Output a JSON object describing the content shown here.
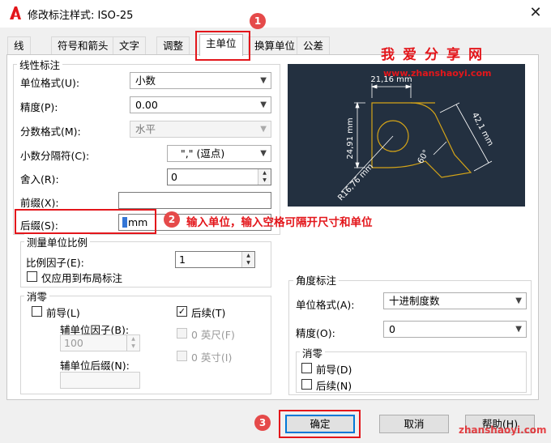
{
  "window": {
    "title": "修改标注样式: ISO-25",
    "close_glyph": "✕"
  },
  "tabs": [
    "线",
    "符号和箭头",
    "文字",
    "调整",
    "主单位",
    "换算单位",
    "公差"
  ],
  "linear": {
    "group_title": "线性标注",
    "unit_format_label": "单位格式(U):",
    "unit_format_value": "小数",
    "precision_label": "精度(P):",
    "precision_value": "0.00",
    "fraction_format_label": "分数格式(M):",
    "fraction_format_value": "水平",
    "decimal_sep_label": "小数分隔符(C):",
    "decimal_sep_value": "\",\" (逗点)",
    "round_label": "舍入(R):",
    "round_value": "0",
    "prefix_label": "前缀(X):",
    "prefix_value": "",
    "suffix_label": "后缀(S):",
    "suffix_value": "mm"
  },
  "scale": {
    "group_title": "测量单位比例",
    "factor_label": "比例因子(E):",
    "factor_value": "1",
    "layout_only_label": "仅应用到布局标注"
  },
  "zero_suppression": {
    "group_title": "消零",
    "leading_label": "前导(L)",
    "trailing_label": "后续(T)",
    "sub_unit_factor_label": "辅单位因子(B):",
    "sub_unit_factor_value": "100",
    "sub_unit_suffix_label": "辅单位后缀(N):",
    "sub_unit_suffix_value": "",
    "feet_label": "0 英尺(F)",
    "inches_label": "0 英寸(I)"
  },
  "angular": {
    "group_title": "角度标注",
    "unit_format_label": "单位格式(A):",
    "unit_format_value": "十进制度数",
    "precision_label": "精度(O):",
    "precision_value": "0",
    "zero_group_title": "消零",
    "leading_label": "前导(D)",
    "trailing_label": "后续(N)"
  },
  "preview": {
    "dim_top": "21,16 mm",
    "dim_left": "24,91 mm",
    "dim_right": "42,1 mm",
    "dim_angle": "60°",
    "dim_radius": "R16,76 mm"
  },
  "buttons": {
    "ok": "确定",
    "cancel": "取消",
    "help": "帮助(H)"
  },
  "annotations": {
    "step1": "1",
    "step2": "2",
    "step3": "3",
    "step2_text": "输入单位，输入空格可隔开尺寸和单位",
    "brand": "我爱分享网",
    "url_top": "www.zhanshaoyi.com",
    "url_bottom": "zhanshaoyi.com"
  },
  "colors": {
    "annotation_red": "#e3161b",
    "preview_bg": "#233040",
    "preview_line": "#d4a418",
    "preview_dim": "#ffffff"
  }
}
